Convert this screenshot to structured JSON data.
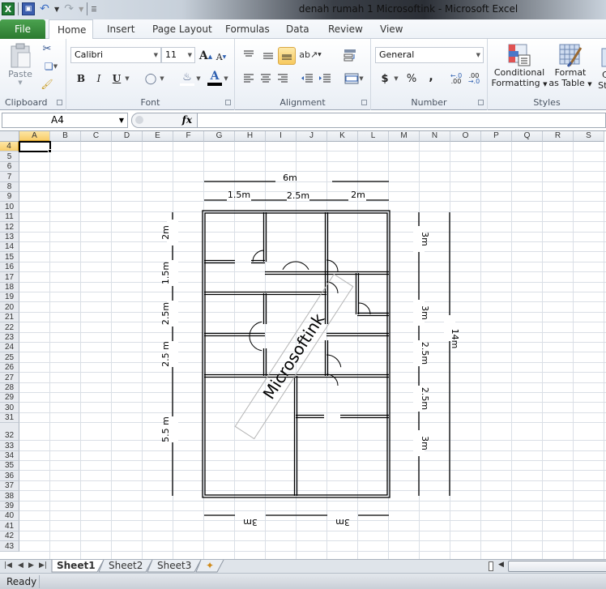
{
  "window": {
    "title": "denah rumah 1 Microsoftink  -  Microsoft Excel"
  },
  "quick_access": {
    "icons": [
      "excel-icon",
      "save-icon",
      "undo-icon",
      "redo-icon",
      "customize-icon"
    ]
  },
  "ribbon_tabs": [
    {
      "label": "File",
      "active": false
    },
    {
      "label": "Home",
      "active": true
    },
    {
      "label": "Insert",
      "active": false
    },
    {
      "label": "Page Layout",
      "active": false
    },
    {
      "label": "Formulas",
      "active": false
    },
    {
      "label": "Data",
      "active": false
    },
    {
      "label": "Review",
      "active": false
    },
    {
      "label": "View",
      "active": false
    }
  ],
  "ribbon": {
    "clipboard": {
      "label": "Clipboard",
      "paste_label": "Paste"
    },
    "font": {
      "label": "Font",
      "font_name": "Calibri",
      "font_size": "11",
      "bold": "B",
      "italic": "I",
      "underline": "U"
    },
    "alignment": {
      "label": "Alignment"
    },
    "number": {
      "label": "Number",
      "format": "General",
      "currency": "$",
      "percent": "%",
      "comma": ",",
      "inc_decimal": ".00",
      "dec_decimal": ".0"
    },
    "styles": {
      "label": "Styles",
      "conditional_line1": "Conditional",
      "conditional_line2": "Formatting",
      "format_table_line1": "Format",
      "format_table_line2": "as Table",
      "cell_styles_line1": "C",
      "cell_styles_line2": "Sty"
    }
  },
  "formula_bar": {
    "name_box": "A4",
    "fx_label": "fx",
    "value": ""
  },
  "grid": {
    "columns": [
      "A",
      "B",
      "C",
      "D",
      "E",
      "F",
      "G",
      "H",
      "I",
      "J",
      "K",
      "L",
      "M",
      "N",
      "O",
      "P",
      "Q",
      "R",
      "S"
    ],
    "rows": [
      "4",
      "5",
      "6",
      "7",
      "8",
      "9",
      "10",
      "11",
      "12",
      "13",
      "14",
      "15",
      "16",
      "17",
      "18",
      "19",
      "20",
      "21",
      "22",
      "23",
      "24",
      "25",
      "26",
      "27",
      "28",
      "29",
      "30",
      "31",
      "32",
      "33",
      "34",
      "35",
      "36",
      "37",
      "38",
      "39",
      "40",
      "41",
      "42",
      "43"
    ],
    "selected_cell": "A4",
    "selected_column": "A",
    "selected_row": "4"
  },
  "floor_plan": {
    "top_total": "6m",
    "top_segments": [
      "1.5m",
      "2.5m",
      "2m"
    ],
    "left_segments": [
      "2m",
      "1.5m",
      "2.5m",
      "2.5 m",
      "5.5 m"
    ],
    "right_segments": [
      "3m",
      "3m",
      "2.5m",
      "2.5m",
      "3m"
    ],
    "right_total": "14m",
    "bottom_segments": [
      "3m",
      "3m"
    ],
    "watermark": "Microsoftink"
  },
  "sheets": [
    {
      "label": "Sheet1",
      "active": true
    },
    {
      "label": "Sheet2",
      "active": false
    },
    {
      "label": "Sheet3",
      "active": false
    }
  ],
  "status": {
    "text": "Ready"
  }
}
